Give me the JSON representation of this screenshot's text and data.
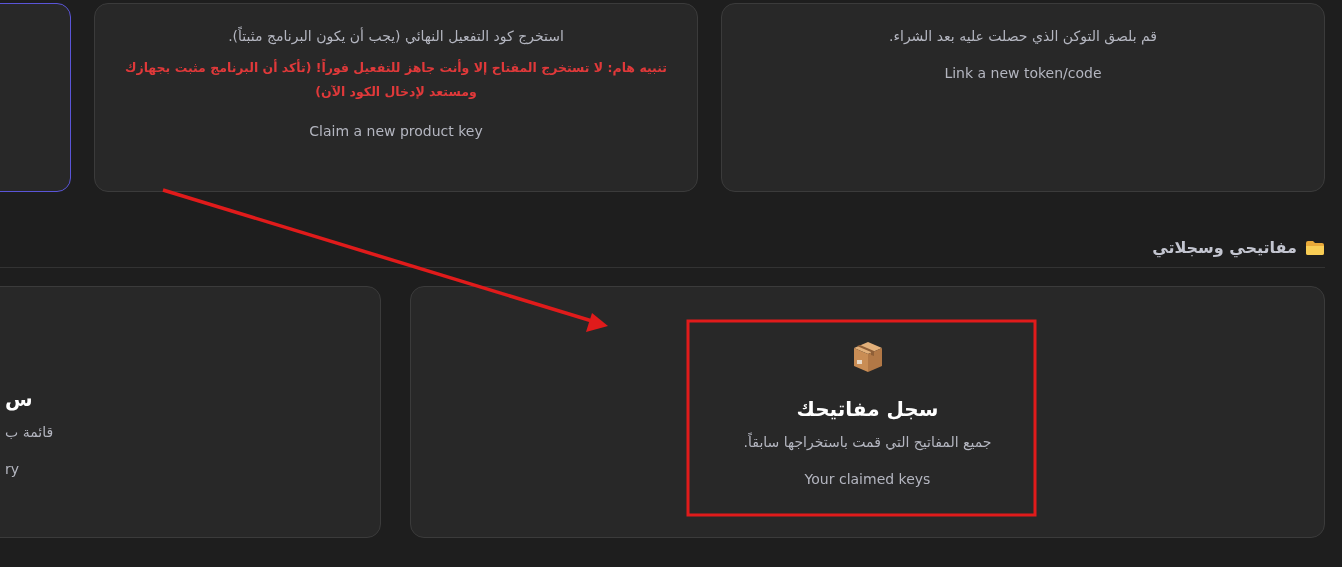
{
  "top_cards": [
    {
      "kind": "full",
      "selected": false,
      "description": "قم بلصق التوكن الذي حصلت عليه بعد الشراء.",
      "subtitle": "Link a new token/code"
    },
    {
      "kind": "full",
      "selected": false,
      "description": "استخرج كود التفعيل النهائي (يجب أن يكون البرنامج مثبتاً).",
      "warning": "تنبيه هام: لا تستخرج المفتاح إلا وأنت جاهز للتفعيل فوراً! (تأكد أن البرنامج مثبت بجهازك ومستعد لإدخال الكود الآن)",
      "subtitle": "Claim a new product key"
    },
    {
      "kind": "cut",
      "selected": true
    }
  ],
  "section": {
    "title": "مفاتيحي وسجلاتي"
  },
  "bottom_cards": [
    {
      "kind": "full",
      "selected": false,
      "title": "سجل مفاتيحك",
      "description": "جميع المفاتيح التي قمت باستخراجها سابقاً.",
      "subtitle": "Your claimed keys"
    },
    {
      "kind": "cut",
      "selected": false,
      "title": "س",
      "description": "قائمة ب",
      "subtitle": "ry"
    }
  ]
}
